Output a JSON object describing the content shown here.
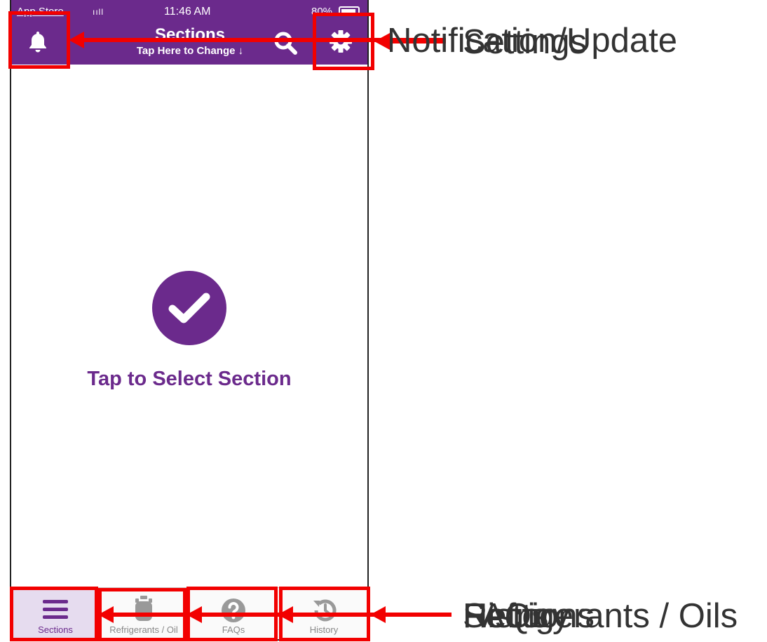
{
  "status_bar": {
    "carrier": "App Store",
    "signal": "ııll",
    "time": "11:46 AM",
    "battery": "80%"
  },
  "nav": {
    "title": "Sections",
    "subtitle": "Tap Here to Change ↓"
  },
  "main": {
    "cta": "Tap to Select Section"
  },
  "tabs": [
    {
      "label": "Sections",
      "active": true
    },
    {
      "label": "Refrigerants / Oil",
      "active": false
    },
    {
      "label": "FAQs",
      "active": false
    },
    {
      "label": "History",
      "active": false
    }
  ],
  "annotations": {
    "top_labels": [
      "Notification/Update",
      "Settings"
    ],
    "bottom_labels": [
      "Sections",
      "Refrigerants / Oils",
      "FAQs",
      "History"
    ]
  },
  "colors": {
    "brand": "#6b2a8c",
    "annotation": "#f20000"
  }
}
